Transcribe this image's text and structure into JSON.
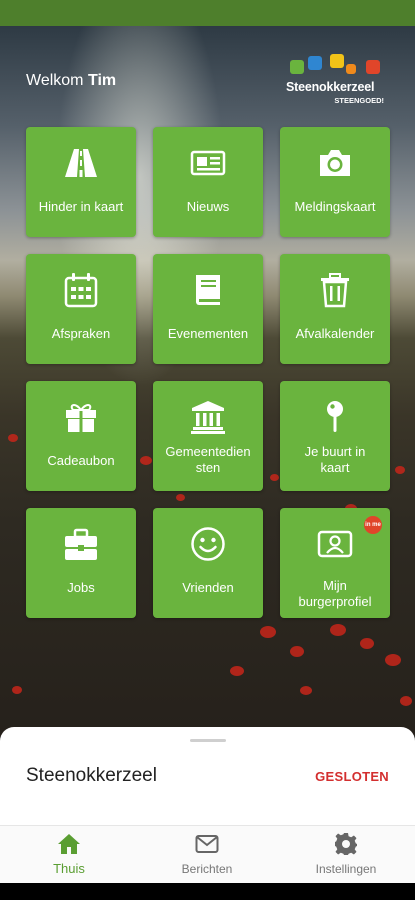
{
  "header": {
    "greeting": "Welkom",
    "user_name": "Tim",
    "logo_title": "Steenokkerzeel",
    "logo_subtitle": "STEENGOED!"
  },
  "tiles": [
    {
      "label": "Hinder in kaart",
      "icon": "road-icon"
    },
    {
      "label": "Nieuws",
      "icon": "newspaper-icon"
    },
    {
      "label": "Meldingskaart",
      "icon": "camera-icon"
    },
    {
      "label": "Afspraken",
      "icon": "calendar-icon"
    },
    {
      "label": "Evenementen",
      "icon": "book-icon"
    },
    {
      "label": "Afvalkalender",
      "icon": "trash-icon"
    },
    {
      "label": "Cadeaubon",
      "icon": "gift-icon"
    },
    {
      "label": "Gemeentediensten",
      "label_line1": "Gemeentedien",
      "label_line2": "sten",
      "icon": "town-hall-icon"
    },
    {
      "label": "Je buurt in kaart",
      "label_line1": "Je buurt in",
      "label_line2": "kaart",
      "icon": "map-pin-icon"
    },
    {
      "label": "Jobs",
      "icon": "briefcase-icon"
    },
    {
      "label": "Vrienden",
      "icon": "smiley-icon"
    },
    {
      "label": "Mijn burgerprofiel",
      "label_line1": "Mijn",
      "label_line2": "burgerprofiel",
      "icon": "id-profile-icon",
      "badge": "in me"
    }
  ],
  "sheet": {
    "title": "Steenokkerzeel",
    "status": "GESLOTEN"
  },
  "nav": {
    "items": [
      {
        "label": "Thuis",
        "icon": "home-icon",
        "active": true
      },
      {
        "label": "Berichten",
        "icon": "mail-icon",
        "active": false
      },
      {
        "label": "Instellingen",
        "icon": "gear-icon",
        "active": false
      }
    ]
  },
  "colors": {
    "tile": "#6ab43e",
    "status_bar": "#4e7f2c",
    "closed": "#d32f2f",
    "nav_active": "#5a9e32"
  }
}
